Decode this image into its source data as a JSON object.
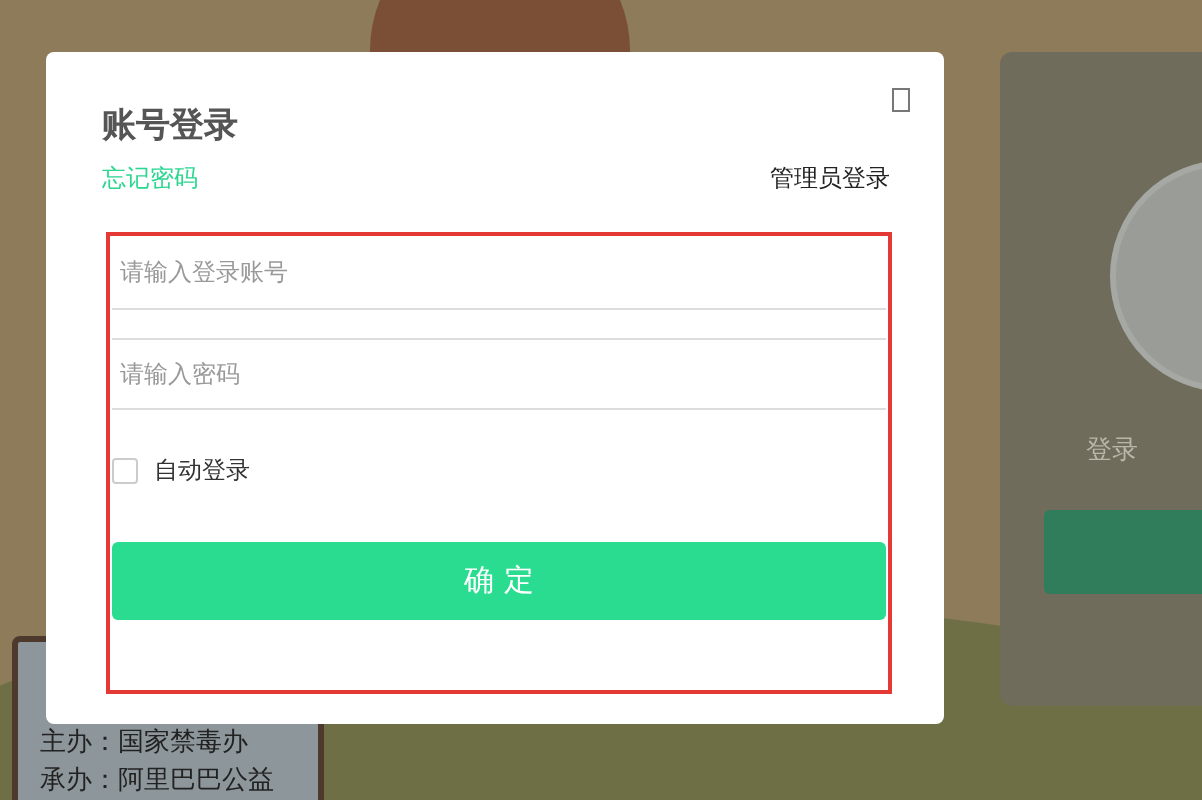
{
  "background": {
    "credits": [
      "主办：国家禁毒办",
      "承办：阿里巴巴公益"
    ]
  },
  "side_panel": {
    "text": "登录"
  },
  "dialog": {
    "title": "账号登录",
    "forgot_link": "忘记密码",
    "admin_link": "管理员登录",
    "fields": [
      {
        "placeholder": "请输入登录账号"
      },
      {
        "placeholder": "请输入密码"
      }
    ],
    "auto_login": {
      "label": "自动登录",
      "checked": false
    },
    "submit": "确 定"
  }
}
